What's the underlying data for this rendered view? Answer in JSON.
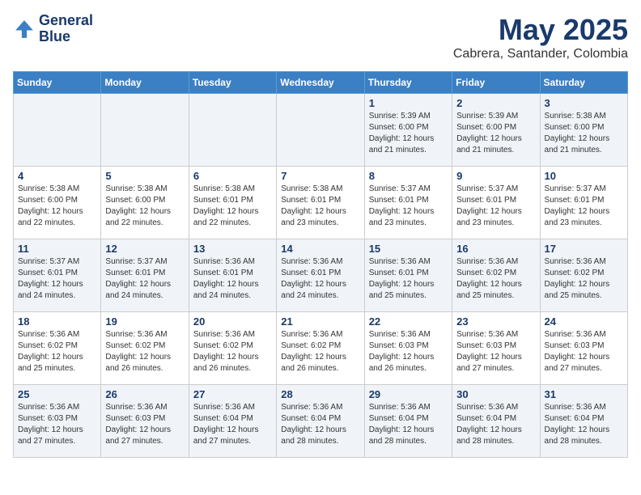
{
  "header": {
    "logo_line1": "General",
    "logo_line2": "Blue",
    "month": "May 2025",
    "location": "Cabrera, Santander, Colombia"
  },
  "weekdays": [
    "Sunday",
    "Monday",
    "Tuesday",
    "Wednesday",
    "Thursday",
    "Friday",
    "Saturday"
  ],
  "weeks": [
    [
      {
        "day": "",
        "info": ""
      },
      {
        "day": "",
        "info": ""
      },
      {
        "day": "",
        "info": ""
      },
      {
        "day": "",
        "info": ""
      },
      {
        "day": "1",
        "info": "Sunrise: 5:39 AM\nSunset: 6:00 PM\nDaylight: 12 hours\nand 21 minutes."
      },
      {
        "day": "2",
        "info": "Sunrise: 5:39 AM\nSunset: 6:00 PM\nDaylight: 12 hours\nand 21 minutes."
      },
      {
        "day": "3",
        "info": "Sunrise: 5:38 AM\nSunset: 6:00 PM\nDaylight: 12 hours\nand 21 minutes."
      }
    ],
    [
      {
        "day": "4",
        "info": "Sunrise: 5:38 AM\nSunset: 6:00 PM\nDaylight: 12 hours\nand 22 minutes."
      },
      {
        "day": "5",
        "info": "Sunrise: 5:38 AM\nSunset: 6:00 PM\nDaylight: 12 hours\nand 22 minutes."
      },
      {
        "day": "6",
        "info": "Sunrise: 5:38 AM\nSunset: 6:01 PM\nDaylight: 12 hours\nand 22 minutes."
      },
      {
        "day": "7",
        "info": "Sunrise: 5:38 AM\nSunset: 6:01 PM\nDaylight: 12 hours\nand 23 minutes."
      },
      {
        "day": "8",
        "info": "Sunrise: 5:37 AM\nSunset: 6:01 PM\nDaylight: 12 hours\nand 23 minutes."
      },
      {
        "day": "9",
        "info": "Sunrise: 5:37 AM\nSunset: 6:01 PM\nDaylight: 12 hours\nand 23 minutes."
      },
      {
        "day": "10",
        "info": "Sunrise: 5:37 AM\nSunset: 6:01 PM\nDaylight: 12 hours\nand 23 minutes."
      }
    ],
    [
      {
        "day": "11",
        "info": "Sunrise: 5:37 AM\nSunset: 6:01 PM\nDaylight: 12 hours\nand 24 minutes."
      },
      {
        "day": "12",
        "info": "Sunrise: 5:37 AM\nSunset: 6:01 PM\nDaylight: 12 hours\nand 24 minutes."
      },
      {
        "day": "13",
        "info": "Sunrise: 5:36 AM\nSunset: 6:01 PM\nDaylight: 12 hours\nand 24 minutes."
      },
      {
        "day": "14",
        "info": "Sunrise: 5:36 AM\nSunset: 6:01 PM\nDaylight: 12 hours\nand 24 minutes."
      },
      {
        "day": "15",
        "info": "Sunrise: 5:36 AM\nSunset: 6:01 PM\nDaylight: 12 hours\nand 25 minutes."
      },
      {
        "day": "16",
        "info": "Sunrise: 5:36 AM\nSunset: 6:02 PM\nDaylight: 12 hours\nand 25 minutes."
      },
      {
        "day": "17",
        "info": "Sunrise: 5:36 AM\nSunset: 6:02 PM\nDaylight: 12 hours\nand 25 minutes."
      }
    ],
    [
      {
        "day": "18",
        "info": "Sunrise: 5:36 AM\nSunset: 6:02 PM\nDaylight: 12 hours\nand 25 minutes."
      },
      {
        "day": "19",
        "info": "Sunrise: 5:36 AM\nSunset: 6:02 PM\nDaylight: 12 hours\nand 26 minutes."
      },
      {
        "day": "20",
        "info": "Sunrise: 5:36 AM\nSunset: 6:02 PM\nDaylight: 12 hours\nand 26 minutes."
      },
      {
        "day": "21",
        "info": "Sunrise: 5:36 AM\nSunset: 6:02 PM\nDaylight: 12 hours\nand 26 minutes."
      },
      {
        "day": "22",
        "info": "Sunrise: 5:36 AM\nSunset: 6:03 PM\nDaylight: 12 hours\nand 26 minutes."
      },
      {
        "day": "23",
        "info": "Sunrise: 5:36 AM\nSunset: 6:03 PM\nDaylight: 12 hours\nand 27 minutes."
      },
      {
        "day": "24",
        "info": "Sunrise: 5:36 AM\nSunset: 6:03 PM\nDaylight: 12 hours\nand 27 minutes."
      }
    ],
    [
      {
        "day": "25",
        "info": "Sunrise: 5:36 AM\nSunset: 6:03 PM\nDaylight: 12 hours\nand 27 minutes."
      },
      {
        "day": "26",
        "info": "Sunrise: 5:36 AM\nSunset: 6:03 PM\nDaylight: 12 hours\nand 27 minutes."
      },
      {
        "day": "27",
        "info": "Sunrise: 5:36 AM\nSunset: 6:04 PM\nDaylight: 12 hours\nand 27 minutes."
      },
      {
        "day": "28",
        "info": "Sunrise: 5:36 AM\nSunset: 6:04 PM\nDaylight: 12 hours\nand 28 minutes."
      },
      {
        "day": "29",
        "info": "Sunrise: 5:36 AM\nSunset: 6:04 PM\nDaylight: 12 hours\nand 28 minutes."
      },
      {
        "day": "30",
        "info": "Sunrise: 5:36 AM\nSunset: 6:04 PM\nDaylight: 12 hours\nand 28 minutes."
      },
      {
        "day": "31",
        "info": "Sunrise: 5:36 AM\nSunset: 6:04 PM\nDaylight: 12 hours\nand 28 minutes."
      }
    ]
  ]
}
